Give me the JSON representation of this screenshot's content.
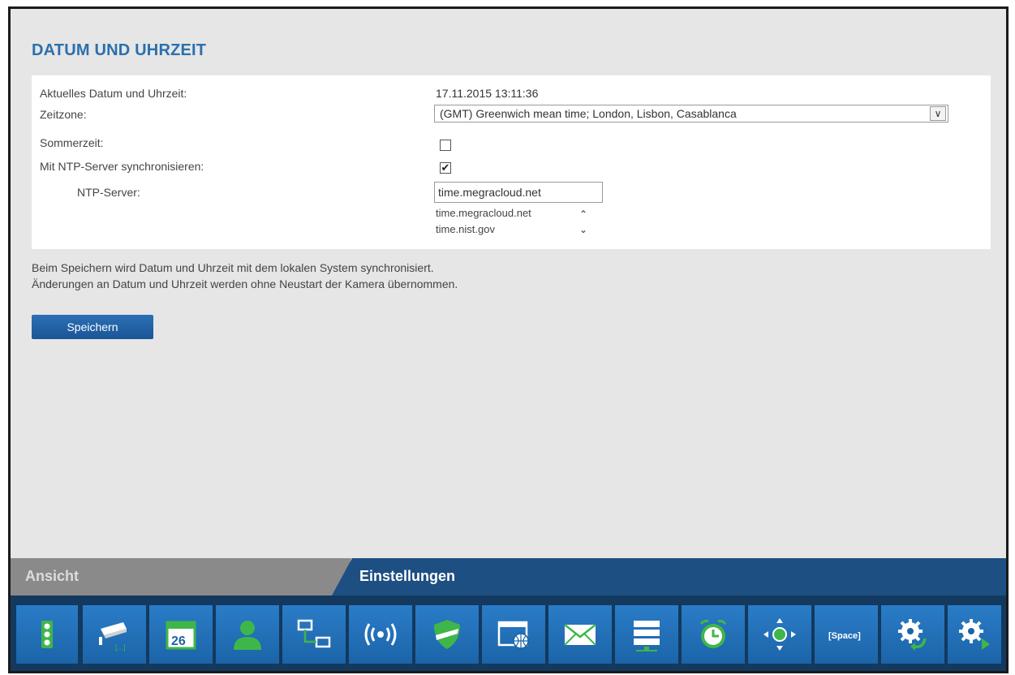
{
  "page": {
    "title": "DATUM UND UHRZEIT"
  },
  "form": {
    "current_datetime_label": "Aktuelles Datum und Uhrzeit:",
    "current_datetime_value": "17.11.2015 13:11:36",
    "timezone_label": "Zeitzone:",
    "timezone_value": "(GMT) Greenwich mean time; London, Lisbon, Casablanca",
    "dst_label": "Sommerzeit:",
    "dst_checked": false,
    "ntp_sync_label": "Mit NTP-Server synchronisieren:",
    "ntp_sync_checked": true,
    "ntp_server_label": "NTP-Server:",
    "ntp_server_value": "time.megracloud.net",
    "ntp_server_options": [
      "time.megracloud.net",
      "time.nist.gov"
    ]
  },
  "info": {
    "line1": "Beim Speichern wird Datum und Uhrzeit mit dem lokalen System synchronisiert.",
    "line2": "Änderungen an Datum und Uhrzeit werden ohne Neustart der Kamera übernommen."
  },
  "buttons": {
    "save_label": "Speichern"
  },
  "tabs": {
    "view_label": "Ansicht",
    "settings_label": "Einstellungen",
    "active": "Einstellungen"
  },
  "icons": [
    "traffic-light-icon",
    "camera-icon",
    "calendar-icon",
    "user-icon",
    "network-icon",
    "wireless-icon",
    "shield-icon",
    "web-icon",
    "mail-icon",
    "storage-icon",
    "alarm-clock-icon",
    "ptz-icon",
    "space-icon",
    "settings-refresh-icon",
    "settings-play-icon"
  ],
  "icon_texts": {
    "calendar_day": "26",
    "space": "[Space]",
    "camera_bracket": "[...]"
  },
  "colors": {
    "title": "#2b6fae",
    "accent_blue": "#1e4f82",
    "icon_green": "#3fb64a"
  }
}
